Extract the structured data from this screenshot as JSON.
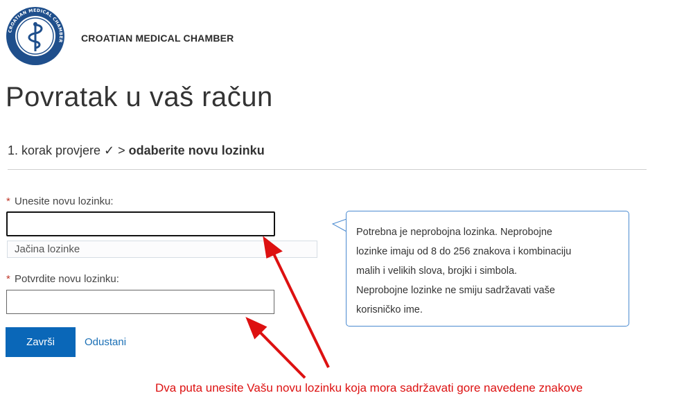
{
  "header": {
    "logo_text": "CROATIAN MEDICAL CHAMBER",
    "brand": "CROATIAN MEDICAL CHAMBER"
  },
  "page": {
    "title": "Povratak u vaš račun"
  },
  "breadcrumb": {
    "step1": "1. korak provjere ✓ >",
    "current": "odaberite novu lozinku"
  },
  "form": {
    "required_mark": "*",
    "new_password_label": "Unesite novu lozinku:",
    "new_password_value": "",
    "strength_label": "Jačina lozinke",
    "confirm_password_label": "Potvrdite novu lozinku:",
    "confirm_password_value": "",
    "submit_label": "Završi",
    "cancel_label": "Odustani"
  },
  "tooltip": {
    "lines": [
      "Potrebna je neprobojna lozinka. Neprobojne",
      "lozinke imaju od 8 do 256 znakova i kombinaciju",
      "malih i velikih slova, brojki i simbola.",
      "Neprobojne lozinke ne smiju sadržavati vaše",
      "korisničko ime."
    ]
  },
  "annotation": {
    "text": "Dva puta unesite Vašu novu lozinku koja mora sadržavati gore navedene znakove"
  },
  "colors": {
    "primary": "#0a67b8",
    "link": "#1a6fb5",
    "annotation": "#dd1111",
    "tooltip_border": "#4a8ad0",
    "logo": "#1f4f8c"
  }
}
